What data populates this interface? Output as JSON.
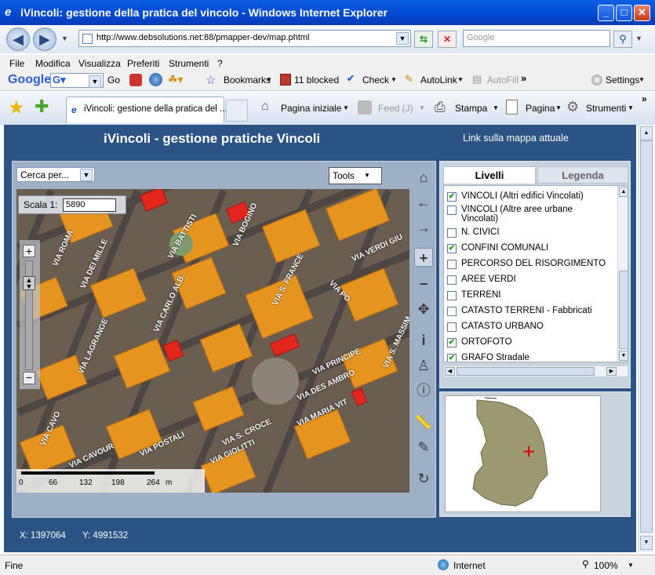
{
  "window": {
    "title": "iVincoli: gestione della pratica del vincolo - Windows Internet Explorer",
    "minimize": "_",
    "maximize": "□",
    "close": "✕"
  },
  "address_bar": {
    "url": "http://www.debsolutions.net:88/pmapper-dev/map.phtml",
    "search_placeholder": "Google"
  },
  "menu": [
    "File",
    "Modifica",
    "Visualizza",
    "Preferiti",
    "Strumenti",
    "?"
  ],
  "google_toolbar": {
    "logo": "Google",
    "go": "Go",
    "bookmarks": "Bookmarks",
    "blocked": "11 blocked",
    "check": "Check",
    "autolink": "AutoLink",
    "autofill": "AutoFill",
    "settings": "Settings"
  },
  "tab_bar": {
    "tab_title": "iVincoli: gestione della pratica del ...",
    "home": "Pagina iniziale",
    "feed": "Feed (J)",
    "print": "Stampa",
    "page": "Pagina",
    "tools": "Strumenti"
  },
  "app": {
    "title": "iVincoli - gestione pratiche Vincoli",
    "link": "Link sulla mappa attuale",
    "search_select": "Cerca per...",
    "tools_select": "Tools",
    "scale_label": "Scala 1:",
    "scale_value": "5890",
    "scalebar_ticks": [
      "0",
      "66",
      "132",
      "198",
      "264"
    ],
    "scalebar_unit": "m",
    "coords_x": "X: 1397064",
    "coords_y": "Y: 4991532"
  },
  "panel": {
    "tab_layers": "Livelli",
    "tab_legend": "Legenda",
    "layers": [
      {
        "label": "VINCOLI (Altri edifici Vincolati)",
        "checked": true
      },
      {
        "label": "VINCOLI (Altre aree urbane Vincolati)",
        "checked": false
      },
      {
        "label": "N. CIVICI",
        "checked": false
      },
      {
        "label": "CONFINI COMUNALI",
        "checked": true
      },
      {
        "label": "PERCORSO DEL RISORGIMENTO",
        "checked": false
      },
      {
        "label": "AREE VERDI",
        "checked": false
      },
      {
        "label": "TERRENI",
        "checked": false
      },
      {
        "label": "CATASTO TERRENI - Fabbricati",
        "checked": false
      },
      {
        "label": "CATASTO URBANO",
        "checked": false
      },
      {
        "label": "ORTOFOTO",
        "checked": true
      },
      {
        "label": "GRAFO Stradale",
        "checked": true
      }
    ]
  },
  "map_labels": [
    "VIA BATTISTI",
    "VIA BOGINO",
    "VIA ROMA",
    "VIA DEI MILLE",
    "VIA CARLO ALB.",
    "VIA S. FRANCE",
    "VIA PO",
    "VIA VERDI GIU",
    "VIA LAGRANGE",
    "VIA PRINCIPE",
    "VIA DES AMBRO",
    "VIA S. MASSIM",
    "VIA MARIA VIT",
    "VIA S. CROCE",
    "VIA CAVOUR",
    "VIA GIOLITTI",
    "VIA CAVO",
    "VIA POSTALI"
  ],
  "status": {
    "left": "Fine",
    "zone": "Internet",
    "zoom": "100%"
  },
  "colors": {
    "titlebar": "#0048d0",
    "page_bg": "#2b5384",
    "building": "#e59420",
    "vincolo": "#e2261c"
  }
}
